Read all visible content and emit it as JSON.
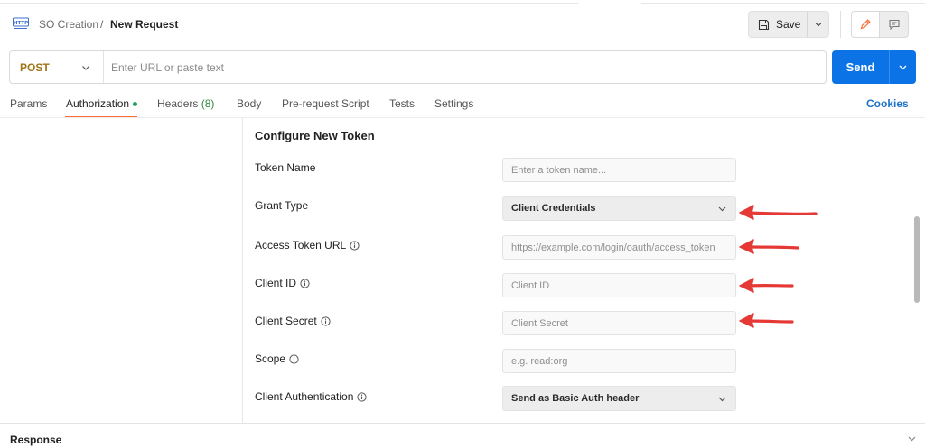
{
  "header": {
    "breadcrumb_parent": "SO Creation",
    "breadcrumb_separator": "/",
    "breadcrumb_current": "New Request",
    "save_label": "Save"
  },
  "request": {
    "method": "POST",
    "url_placeholder": "Enter URL or paste text",
    "send_label": "Send"
  },
  "tabs": {
    "params": "Params",
    "authorization": "Authorization",
    "headers": "Headers",
    "headers_count": "(8)",
    "body": "Body",
    "pre_request_script": "Pre-request Script",
    "tests": "Tests",
    "settings": "Settings",
    "cookies": "Cookies"
  },
  "token_form": {
    "title": "Configure New Token",
    "token_name_label": "Token Name",
    "token_name_placeholder": "Enter a token name...",
    "grant_type_label": "Grant Type",
    "grant_type_value": "Client Credentials",
    "access_token_url_label": "Access Token URL",
    "access_token_url_placeholder": "https://example.com/login/oauth/access_token",
    "client_id_label": "Client ID",
    "client_id_placeholder": "Client ID",
    "client_secret_label": "Client Secret",
    "client_secret_placeholder": "Client Secret",
    "scope_label": "Scope",
    "scope_placeholder": "e.g. read:org",
    "client_authentication_label": "Client Authentication",
    "client_authentication_value": "Send as Basic Auth header"
  },
  "response": {
    "label": "Response"
  },
  "colors": {
    "accent": "#ff6c37",
    "send": "#0b73e6",
    "method": "#a0761b",
    "annotation_arrow": "#e53935"
  },
  "icons": {
    "http": "http-icon",
    "save": "floppy-disk-icon",
    "edit": "pencil-icon",
    "comment": "comment-icon",
    "info": "info-icon",
    "chevron": "chevron-down-icon"
  }
}
